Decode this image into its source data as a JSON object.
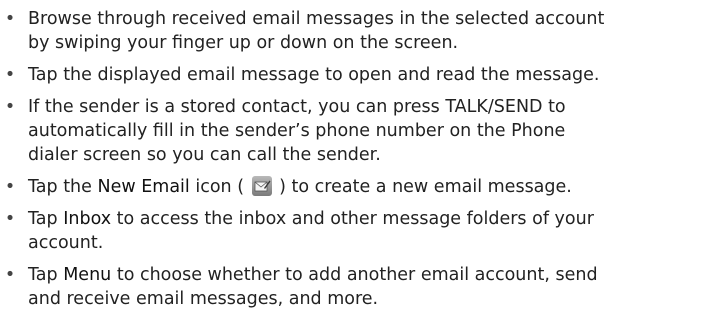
{
  "bullet_glyph": "•",
  "items": [
    {
      "lines": [
        "Browse through received email messages in the selected account",
        "by swiping your finger up or down on the screen."
      ]
    },
    {
      "lines": [
        "Tap the displayed email message to open and read the message."
      ]
    },
    {
      "lines": [
        "If the sender is a stored contact, you can press TALK/SEND to",
        "automatically fill in the sender’s phone number on the Phone",
        "dialer screen so you can call the sender."
      ]
    },
    {
      "before": "Tap the ",
      "term": "New Email",
      "middle": " icon ( ",
      "icon": "new-email-icon",
      "after": " ) to create a new email message."
    },
    {
      "line1_before": "Tap ",
      "term": "Inbox",
      "line1_after": " to access the inbox and other message folders of your",
      "line2": "account."
    },
    {
      "line1_before": "Tap ",
      "term": "Menu",
      "line1_after": " to choose whether to add another email account, send",
      "line2": "and receive email messages, and more."
    }
  ]
}
